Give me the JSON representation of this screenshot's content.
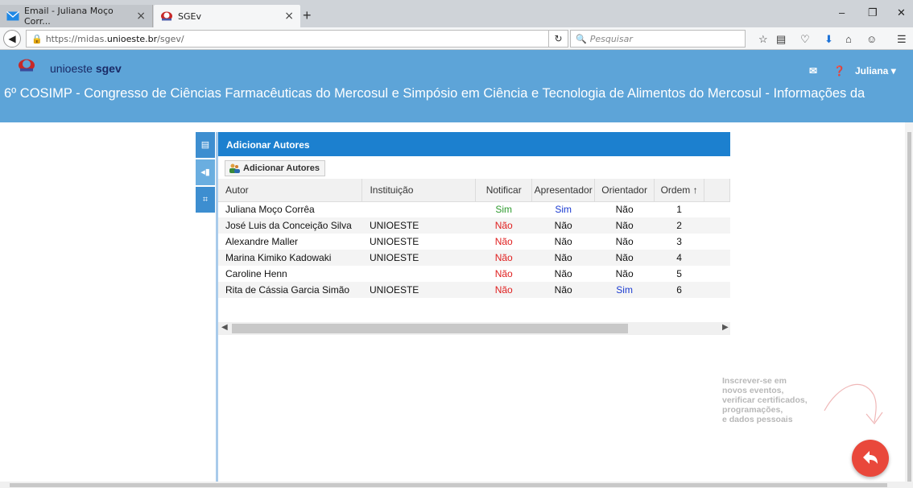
{
  "browser": {
    "tabs": [
      {
        "label": "Email - Juliana Moço Corr...",
        "active": false
      },
      {
        "label": "SGEv",
        "active": true
      }
    ],
    "new_tab": "+",
    "url_prefix": "https://midas.",
    "url_domain": "unioeste.br",
    "url_suffix": "/sgev/",
    "search_placeholder": "Pesquisar",
    "window_min": "–",
    "window_max": "❐",
    "window_close": "✕"
  },
  "header": {
    "brand_name": "unioeste",
    "brand_app": "sgev",
    "user_name": "Juliana",
    "event_title": "6º COSIMP - Congresso de Ciências Farmacêuticas do Mercosul e Simpósio em Ciência e Tecnologia de Alimentos do Mercosul - Informações da"
  },
  "panel": {
    "title": "Adicionar Autores",
    "add_button_label": "Adicionar Autores",
    "columns": [
      "Autor",
      "Instituição",
      "Notificar",
      "Apresentador",
      "Orientador",
      "Ordem ↑"
    ],
    "rows": [
      {
        "autor": "Juliana Moço Corrêa",
        "instituicao": "",
        "notificar": "Sim",
        "apresentador": "Sim",
        "orientador": "Não",
        "ordem": "1"
      },
      {
        "autor": "José Luis da Conceição Silva",
        "instituicao": "UNIOESTE",
        "notificar": "Não",
        "apresentador": "Não",
        "orientador": "Não",
        "ordem": "2"
      },
      {
        "autor": "Alexandre Maller",
        "instituicao": "UNIOESTE",
        "notificar": "Não",
        "apresentador": "Não",
        "orientador": "Não",
        "ordem": "3"
      },
      {
        "autor": "Marina Kimiko Kadowaki",
        "instituicao": "UNIOESTE",
        "notificar": "Não",
        "apresentador": "Não",
        "orientador": "Não",
        "ordem": "4"
      },
      {
        "autor": "Caroline Henn",
        "instituicao": "",
        "notificar": "Não",
        "apresentador": "Não",
        "orientador": "Não",
        "ordem": "5"
      },
      {
        "autor": "Rita de Cássia Garcia Simão",
        "instituicao": "UNIOESTE",
        "notificar": "Não",
        "apresentador": "Não",
        "orientador": "Sim",
        "ordem": "6"
      }
    ]
  },
  "hint": {
    "lines": [
      "Inscrever-se em",
      "novos eventos,",
      "verificar certificados,",
      "programações,",
      "e dados pessoais"
    ]
  },
  "colors": {
    "header_bg": "#5da4d8",
    "panel_header": "#1c80cf",
    "fab": "#e9483b",
    "yes_green": "#2e9a2e",
    "no_red": "#e02020",
    "yes_blue": "#1b3bd0"
  }
}
